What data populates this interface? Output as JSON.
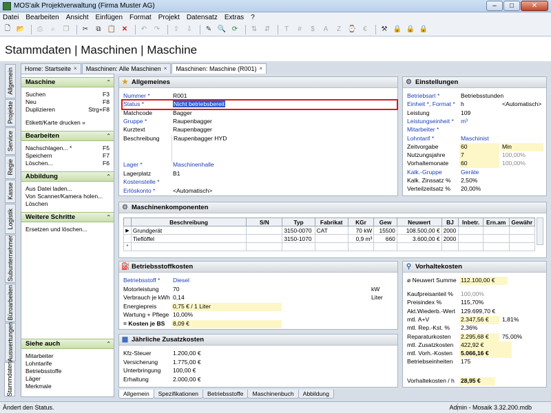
{
  "window": {
    "title": "MOS'aik Projektverwaltung (Firma Muster AG)",
    "min": "–",
    "max": "□",
    "close": "✕"
  },
  "menu": [
    "Datei",
    "Bearbeiten",
    "Ansicht",
    "Einfügen",
    "Format",
    "Projekt",
    "Datensatz",
    "Extras",
    "?"
  ],
  "page_title": "Stammdaten | Maschinen | Maschine",
  "doc_tabs": [
    {
      "label": "Home: Startseite",
      "close": "×"
    },
    {
      "label": "Maschinen: Alle Maschinen",
      "close": "×"
    },
    {
      "label": "Maschinen: Maschine (R001)",
      "close": "×"
    }
  ],
  "vertical_tabs": [
    "Allgemein",
    "Projekte",
    "Service",
    "Regie",
    "Kasse",
    "Logistik",
    "Subunternehmer",
    "Büroarbeiten",
    "Auswertungen",
    "Stammdaten"
  ],
  "sidebar": {
    "maschine": {
      "title": "Maschine",
      "items": [
        {
          "label": "Suchen",
          "key": "F3"
        },
        {
          "label": "Neu",
          "key": "F8"
        },
        {
          "label": "Duplizieren",
          "key": "Strg+F8"
        }
      ],
      "extra": "Etikett/Karte drucken »"
    },
    "bearbeiten": {
      "title": "Bearbeiten",
      "items": [
        {
          "label": "Nachschlagen... *",
          "key": "F5"
        },
        {
          "label": "Speichern",
          "key": "F7"
        },
        {
          "label": "Löschen...",
          "key": "F6"
        }
      ]
    },
    "abbildung": {
      "title": "Abbildung",
      "items": [
        "Aus Datei laden...",
        "Von Scanner/Kamera holen...",
        "Löschen"
      ]
    },
    "weitere": {
      "title": "Weitere Schritte",
      "items": [
        "Ersetzen und löschen..."
      ]
    },
    "siehe": {
      "title": "Siehe auch",
      "items": [
        "Mitarbeiter",
        "Lohntarife",
        "Betriebsstoffe",
        "Läger",
        "Merkmale"
      ]
    }
  },
  "allgemeines": {
    "title": "Allgemeines",
    "fields": {
      "nummer": {
        "label": "Nummer *",
        "value": "R001"
      },
      "status": {
        "label": "Status *",
        "value": "Nicht betriebsbereit"
      },
      "matchcode": {
        "label": "Matchcode",
        "value": "Bagger"
      },
      "gruppe": {
        "label": "Gruppe *",
        "value": "Raupenbagger"
      },
      "kurztext": {
        "label": "Kurztext",
        "value": "Raupenbagger"
      },
      "beschreibung": {
        "label": "Beschreibung",
        "value": "Raupenbagger HYD"
      },
      "lager": {
        "label": "Lager *",
        "value": "Maschinenhalle"
      },
      "lagerplatz": {
        "label": "Lagerplatz",
        "value": "B1"
      },
      "kostenstelle": {
        "label": "Kostenstelle *",
        "value": ""
      },
      "erloeskonto": {
        "label": "Erlöskonto *",
        "value": "<Automatisch>"
      }
    }
  },
  "einstellungen": {
    "title": "Einstellungen",
    "rows": [
      {
        "label": "Betriebsart *",
        "link": true,
        "v1": "Betriebsstunden",
        "v2": ""
      },
      {
        "label": "Einheit *, Format *",
        "link": true,
        "v1": "h",
        "v2": "<Automatisch>"
      },
      {
        "label": "Leistung",
        "link": false,
        "v1": "109",
        "v2": ""
      },
      {
        "label": "Leistungseinheit *",
        "link": true,
        "v1": "m³",
        "v2": ""
      },
      {
        "label": "Mitarbeiter *",
        "link": true,
        "v1": "",
        "v2": ""
      },
      {
        "label": "Lohntarif *",
        "link": true,
        "v1": "Maschinist",
        "v2": ""
      },
      {
        "label": "Zeitvorgabe",
        "link": false,
        "v1": "60",
        "v2": "Min"
      },
      {
        "label": "Nutzungsjahre",
        "link": false,
        "v1": "7",
        "v2": "100,00%"
      },
      {
        "label": "Vorhaltemonate",
        "link": false,
        "v1": "60",
        "v2": "100,00%"
      },
      {
        "label": "Kalk.-Gruppe",
        "link": true,
        "v1": "Geräte",
        "v2": ""
      },
      {
        "label": "Kalk. Zinssatz %",
        "link": false,
        "v1": "2,50%",
        "v2": ""
      },
      {
        "label": "Verteilzeitsatz %",
        "link": false,
        "v1": "20,00%",
        "v2": ""
      }
    ]
  },
  "komponenten": {
    "title": "Maschinenkomponenten",
    "columns": [
      "Beschreibung",
      "S/N",
      "Typ",
      "Fabrikat",
      "KGr",
      "Gew",
      "Neuwert",
      "BJ",
      "Inbetr.",
      "Ern.am",
      "Gewähr"
    ],
    "rows": [
      {
        "marker": "▶",
        "cells": [
          "Grundgerät",
          "",
          "3150-0070",
          "CAT",
          "70 kW",
          "15500",
          "108.500,00 €",
          "2000",
          "",
          "",
          ""
        ]
      },
      {
        "marker": "",
        "cells": [
          "Tieflöffel",
          "",
          "3150-1070",
          "",
          "0,9 m³",
          "660",
          "3.600,00 €",
          "2000",
          "",
          "",
          ""
        ]
      },
      {
        "marker": "*",
        "cells": [
          "",
          "",
          "",
          "",
          "",
          "",
          "",
          "",
          "",
          "",
          ""
        ]
      }
    ]
  },
  "betriebsstoff": {
    "title": "Betriebsstoffkosten",
    "rows": [
      {
        "label": "Betriebsstoff *",
        "link": true,
        "value": "Diesel",
        "unit": ""
      },
      {
        "label": "Motorleistung",
        "link": false,
        "value": "70",
        "unit": "kW"
      },
      {
        "label": "Verbrauch je kWh",
        "link": false,
        "value": "0,14",
        "unit": "Liter"
      },
      {
        "label": "Energiepreis",
        "link": false,
        "value": "0,75 € / 1 Liter",
        "unit": ""
      },
      {
        "label": "Wartung + Pflege",
        "link": false,
        "value": "10,00%",
        "unit": ""
      },
      {
        "label": "= Kosten je BS",
        "link": false,
        "value": "8,09 €",
        "unit": ""
      }
    ]
  },
  "zusatzkosten": {
    "title": "Jährliche Zusatzkosten",
    "rows": [
      {
        "label": "Kfz-Steuer",
        "value": "1.200,00 €"
      },
      {
        "label": "Versicherung",
        "value": "1.775,00 €"
      },
      {
        "label": "Unterbringung",
        "value": "100,00 €"
      },
      {
        "label": "Erhaltung",
        "value": "2.000,00 €"
      }
    ]
  },
  "vorhaltekosten": {
    "title": "Vorhaltekosten",
    "neuwert": {
      "label": "ø Neuwert Summe",
      "value": "112.100,00 €"
    },
    "rows": [
      {
        "label": "Kaufpreisanteil %",
        "v1": "100,00%",
        "v2": ""
      },
      {
        "label": "Preisindex %",
        "v1": "115,70%",
        "v2": ""
      },
      {
        "label": "Akt.Wiederb.-Wert",
        "v1": "129.699,70 €",
        "v2": ""
      },
      {
        "label": "mtl. A+V",
        "v1": "2.347,56 €",
        "v2": "1,81%"
      },
      {
        "label": "mtl. Rep.-Kst. %",
        "v1": "2,36%",
        "v2": ""
      },
      {
        "label": "Reparaturkosten",
        "v1": "2.295,68 €",
        "v2": "75,00%"
      },
      {
        "label": "mtl. Zusatzkosten",
        "v1": "422,92 €",
        "v2": ""
      },
      {
        "label": "mtl. Vorh.-Kosten",
        "v1": "5.066,16 €",
        "v2": ""
      },
      {
        "label": "Betriebseinheiten",
        "v1": "175",
        "v2": ""
      }
    ],
    "total": {
      "label": "Vorhaltekosten / h",
      "value": "28,95 €"
    }
  },
  "bottom_tabs": [
    "Allgemein",
    "Spezifikationen",
    "Betriebsstoffe",
    "Maschinenbuch",
    "Abbildung"
  ],
  "status": {
    "left": "Ändert den Status.",
    "right": "Admin - Mosaik 3.32.200.mdb"
  }
}
